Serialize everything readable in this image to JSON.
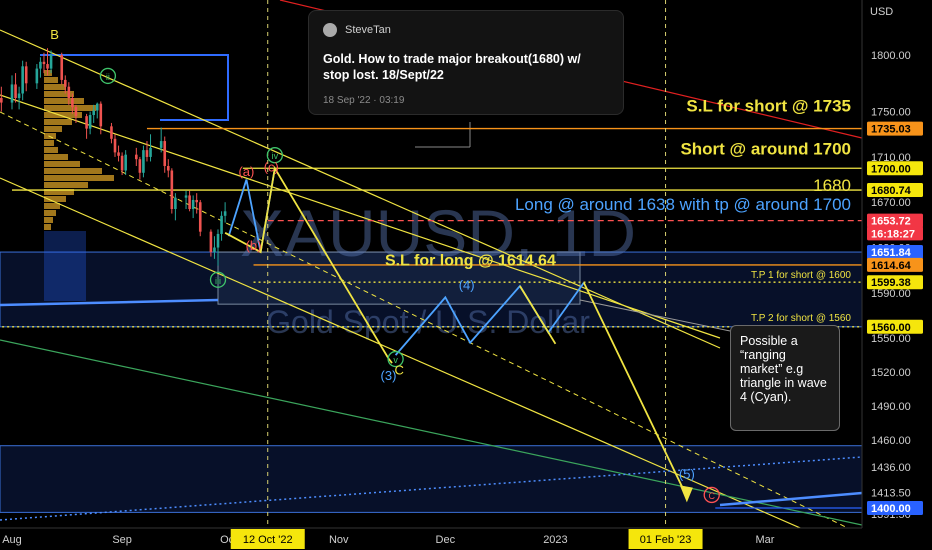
{
  "chart_data": {
    "type": "candlestick",
    "symbol_watermark": "XAUUSD, 1D",
    "name_watermark": "Gold Spot / U.S. Dollar",
    "currency": "USD",
    "ylim": [
      1380,
      1830
    ],
    "y_ticks": [
      1391.5,
      1413.5,
      1436.0,
      1460.0,
      1490.0,
      1520.0,
      1550.0,
      1590.0,
      1630.0,
      1670.0,
      1710.0,
      1750.0,
      1800.0
    ],
    "x_labels": [
      {
        "label": "Aug",
        "date": "2022-08-01"
      },
      {
        "label": "Sep",
        "date": "2022-09-01"
      },
      {
        "label": "Oct",
        "date": "2022-10-01"
      },
      {
        "label": "Nov",
        "date": "2022-11-01"
      },
      {
        "label": "Dec",
        "date": "2022-12-01"
      },
      {
        "label": "2023",
        "date": "2023-01-01"
      },
      {
        "label": "Mar",
        "date": "2023-03-01"
      }
    ],
    "highlight_dates": [
      {
        "label": "12 Oct '22",
        "date": "2022-10-12"
      },
      {
        "label": "01 Feb '23",
        "date": "2023-02-01"
      }
    ],
    "price_labels": [
      {
        "value": "1735.03",
        "price": 1735.03,
        "style": "orange"
      },
      {
        "value": "1700.00",
        "price": 1700.0,
        "style": "yellow"
      },
      {
        "value": "1680.74",
        "price": 1680.74,
        "style": "yellow"
      },
      {
        "value": "1653.72",
        "price": 1653.72,
        "style": "red"
      },
      {
        "value": "16:18:27",
        "price": 1642.5,
        "style": "red"
      },
      {
        "value": "1651.84",
        "price": 1626.0,
        "style": "blue"
      },
      {
        "value": "1614.64",
        "price": 1614.64,
        "style": "orange"
      },
      {
        "value": "1599.38",
        "price": 1599.38,
        "style": "yellow"
      },
      {
        "value": "1560.00",
        "price": 1560.0,
        "style": "yellow"
      },
      {
        "value": "1400.00",
        "price": 1400.0,
        "style": "blue"
      }
    ],
    "levels": [
      {
        "price": 1735.03,
        "color": "#f7931a",
        "from": "2022-09-08"
      },
      {
        "price": 1700.0,
        "color": "#f0e442",
        "from": "2022-10-05"
      },
      {
        "price": 1680.74,
        "color": "#f0e442",
        "from": "2022-08-01"
      },
      {
        "price": 1653.72,
        "color": "#ff5252",
        "from": "2022-10-12",
        "dash": true
      },
      {
        "price": 1614.64,
        "color": "#f7931a",
        "from": "2022-10-08"
      },
      {
        "price": 1599.38,
        "color": "#f0e442",
        "from": "2022-10-08",
        "dotted": true
      },
      {
        "price": 1560.0,
        "color": "#f0e442",
        "from": "2022-07-25",
        "dotted": true
      },
      {
        "price": 1400.0,
        "color": "#2962ff",
        "from": "2023-02-15"
      }
    ],
    "annotations": [
      {
        "text": "S.L for short @ 1735",
        "price": 1750,
        "anchor": "right",
        "color": "#f0e442",
        "size": 17,
        "bold": true
      },
      {
        "text": "Short @ around 1700",
        "price": 1712,
        "anchor": "right",
        "color": "#f0e442",
        "size": 17,
        "bold": true
      },
      {
        "text": "1680",
        "price": 1680,
        "anchor": "right",
        "color": "#f0e442",
        "size": 17,
        "bold": false
      },
      {
        "text": "Long @ around 1638 with tp @ around 1700",
        "price": 1663,
        "anchor": "right",
        "color": "#4da3ff",
        "size": 17,
        "bold": false
      },
      {
        "text": "S.L for long @ 1614.64",
        "date": "2022-11-14",
        "price": 1614,
        "anchor": "start",
        "color": "#f0e442",
        "size": 16,
        "bold": true
      },
      {
        "text": "T.P 1 for short @ 1600",
        "price": 1603,
        "anchor": "right",
        "color": "#f0e442",
        "size": 10,
        "bold": false
      },
      {
        "text": "T.P 2  for short @ 1560",
        "price": 1565,
        "anchor": "right",
        "color": "#f0e442",
        "size": 10,
        "bold": false
      }
    ],
    "wave_labels": [
      {
        "text": "B",
        "date": "2022-08-13",
        "price": 1814,
        "color": "#f0e442"
      },
      {
        "text": "ii",
        "date": "2022-08-28",
        "price": 1778,
        "color": "#3fc46b",
        "circle": true
      },
      {
        "text": "iii",
        "date": "2022-09-28",
        "price": 1598,
        "color": "#3fc46b",
        "circle": true
      },
      {
        "text": "iv",
        "date": "2022-10-14",
        "price": 1708,
        "color": "#3fc46b",
        "circle": true
      },
      {
        "text": "v",
        "date": "2022-11-17",
        "price": 1528,
        "color": "#3fc46b",
        "circle": true
      },
      {
        "text": "(a)",
        "date": "2022-10-06",
        "price": 1693,
        "color": "#ff5252"
      },
      {
        "text": "(b)",
        "date": "2022-10-08",
        "price": 1628,
        "color": "#ff5252"
      },
      {
        "text": "(c)",
        "date": "2022-10-13",
        "price": 1697,
        "color": "#ff5252"
      },
      {
        "text": "(3)",
        "date": "2022-11-15",
        "price": 1513,
        "color": "#4da3ff"
      },
      {
        "text": "C",
        "date": "2022-11-18",
        "price": 1518,
        "color": "#f0e442"
      },
      {
        "text": "(4)",
        "date": "2022-12-07",
        "price": 1593,
        "color": "#4da3ff"
      },
      {
        "text": "(5)",
        "date": "2023-02-07",
        "price": 1426,
        "color": "#4da3ff"
      },
      {
        "text": "C",
        "date": "2023-02-14",
        "price": 1408,
        "color": "#ff5252",
        "circle": true
      }
    ],
    "candles": [
      {
        "date": "2022-07-22",
        "open": 1712,
        "high": 1740,
        "low": 1706,
        "close": 1728
      },
      {
        "date": "2022-07-25",
        "open": 1728,
        "high": 1738,
        "low": 1715,
        "close": 1720
      },
      {
        "date": "2022-07-26",
        "open": 1720,
        "high": 1743,
        "low": 1712,
        "close": 1740
      },
      {
        "date": "2022-07-27",
        "open": 1740,
        "high": 1752,
        "low": 1728,
        "close": 1732
      },
      {
        "date": "2022-07-28",
        "open": 1732,
        "high": 1768,
        "low": 1728,
        "close": 1762
      },
      {
        "date": "2022-07-29",
        "open": 1762,
        "high": 1772,
        "low": 1750,
        "close": 1758
      },
      {
        "date": "2022-08-01",
        "open": 1758,
        "high": 1782,
        "low": 1752,
        "close": 1774
      },
      {
        "date": "2022-08-02",
        "open": 1774,
        "high": 1784,
        "low": 1758,
        "close": 1762
      },
      {
        "date": "2022-08-03",
        "open": 1762,
        "high": 1772,
        "low": 1752,
        "close": 1766
      },
      {
        "date": "2022-08-04",
        "open": 1766,
        "high": 1795,
        "low": 1760,
        "close": 1790
      },
      {
        "date": "2022-08-05",
        "open": 1790,
        "high": 1794,
        "low": 1768,
        "close": 1775
      },
      {
        "date": "2022-08-08",
        "open": 1775,
        "high": 1792,
        "low": 1770,
        "close": 1788
      },
      {
        "date": "2022-08-09",
        "open": 1788,
        "high": 1798,
        "low": 1780,
        "close": 1794
      },
      {
        "date": "2022-08-10",
        "open": 1794,
        "high": 1802,
        "low": 1784,
        "close": 1792
      },
      {
        "date": "2022-08-11",
        "open": 1792,
        "high": 1806,
        "low": 1782,
        "close": 1788
      },
      {
        "date": "2022-08-12",
        "open": 1788,
        "high": 1804,
        "low": 1784,
        "close": 1800
      },
      {
        "date": "2022-08-15",
        "open": 1800,
        "high": 1802,
        "low": 1774,
        "close": 1778
      },
      {
        "date": "2022-08-16",
        "open": 1778,
        "high": 1782,
        "low": 1766,
        "close": 1772
      },
      {
        "date": "2022-08-17",
        "open": 1772,
        "high": 1776,
        "low": 1756,
        "close": 1762
      },
      {
        "date": "2022-08-18",
        "open": 1762,
        "high": 1766,
        "low": 1748,
        "close": 1754
      },
      {
        "date": "2022-08-19",
        "open": 1754,
        "high": 1756,
        "low": 1740,
        "close": 1746
      },
      {
        "date": "2022-08-22",
        "open": 1746,
        "high": 1748,
        "low": 1726,
        "close": 1735
      },
      {
        "date": "2022-08-23",
        "open": 1735,
        "high": 1750,
        "low": 1730,
        "close": 1747
      },
      {
        "date": "2022-08-24",
        "open": 1747,
        "high": 1756,
        "low": 1740,
        "close": 1751
      },
      {
        "date": "2022-08-25",
        "open": 1751,
        "high": 1758,
        "low": 1744,
        "close": 1757
      },
      {
        "date": "2022-08-26",
        "open": 1757,
        "high": 1759,
        "low": 1730,
        "close": 1737
      },
      {
        "date": "2022-08-29",
        "open": 1737,
        "high": 1740,
        "low": 1722,
        "close": 1726
      },
      {
        "date": "2022-08-30",
        "open": 1726,
        "high": 1730,
        "low": 1710,
        "close": 1714
      },
      {
        "date": "2022-08-31",
        "open": 1714,
        "high": 1720,
        "low": 1706,
        "close": 1711
      },
      {
        "date": "2022-09-01",
        "open": 1711,
        "high": 1714,
        "low": 1694,
        "close": 1698
      },
      {
        "date": "2022-09-02",
        "open": 1698,
        "high": 1716,
        "low": 1694,
        "close": 1712
      },
      {
        "date": "2022-09-05",
        "open": 1712,
        "high": 1718,
        "low": 1702,
        "close": 1708
      },
      {
        "date": "2022-09-06",
        "open": 1708,
        "high": 1710,
        "low": 1690,
        "close": 1696
      },
      {
        "date": "2022-09-07",
        "open": 1696,
        "high": 1720,
        "low": 1692,
        "close": 1716
      },
      {
        "date": "2022-09-08",
        "open": 1716,
        "high": 1724,
        "low": 1706,
        "close": 1710
      },
      {
        "date": "2022-09-09",
        "open": 1710,
        "high": 1730,
        "low": 1706,
        "close": 1718
      },
      {
        "date": "2022-09-12",
        "open": 1718,
        "high": 1736,
        "low": 1714,
        "close": 1724
      },
      {
        "date": "2022-09-13",
        "open": 1724,
        "high": 1728,
        "low": 1696,
        "close": 1702
      },
      {
        "date": "2022-09-14",
        "open": 1702,
        "high": 1708,
        "low": 1692,
        "close": 1698
      },
      {
        "date": "2022-09-15",
        "open": 1698,
        "high": 1700,
        "low": 1660,
        "close": 1664
      },
      {
        "date": "2022-09-16",
        "open": 1664,
        "high": 1678,
        "low": 1654,
        "close": 1674
      },
      {
        "date": "2022-09-19",
        "open": 1674,
        "high": 1680,
        "low": 1664,
        "close": 1676
      },
      {
        "date": "2022-09-20",
        "open": 1676,
        "high": 1680,
        "low": 1662,
        "close": 1664
      },
      {
        "date": "2022-09-21",
        "open": 1664,
        "high": 1676,
        "low": 1656,
        "close": 1672
      },
      {
        "date": "2022-09-22",
        "open": 1672,
        "high": 1678,
        "low": 1660,
        "close": 1670
      },
      {
        "date": "2022-09-23",
        "open": 1670,
        "high": 1672,
        "low": 1640,
        "close": 1644
      },
      {
        "date": "2022-09-26",
        "open": 1644,
        "high": 1646,
        "low": 1622,
        "close": 1626
      },
      {
        "date": "2022-09-27",
        "open": 1626,
        "high": 1640,
        "low": 1620,
        "close": 1630
      },
      {
        "date": "2022-09-28",
        "open": 1630,
        "high": 1646,
        "low": 1614,
        "close": 1642
      },
      {
        "date": "2022-09-29",
        "open": 1642,
        "high": 1662,
        "low": 1636,
        "close": 1658
      },
      {
        "date": "2022-09-30",
        "open": 1658,
        "high": 1670,
        "low": 1652,
        "close": 1662
      }
    ]
  },
  "note": {
    "author": "SteveTan",
    "title": "Gold. How to trade major breakout(1680) w/ stop lost. 18/Sept/22",
    "date": "18 Sep '22 · 03:19"
  },
  "callout": {
    "text": "Possible a “ranging market” e.g triangle in wave 4 (Cyan)."
  },
  "colors": {
    "background": "#000000",
    "up": "#26a69a",
    "down": "#ef5350",
    "annotation_yellow": "#f0e442",
    "annotation_blue": "#4da3ff",
    "zone_blue": "#2962ff",
    "highlight_yellow": "#f5e60c"
  }
}
